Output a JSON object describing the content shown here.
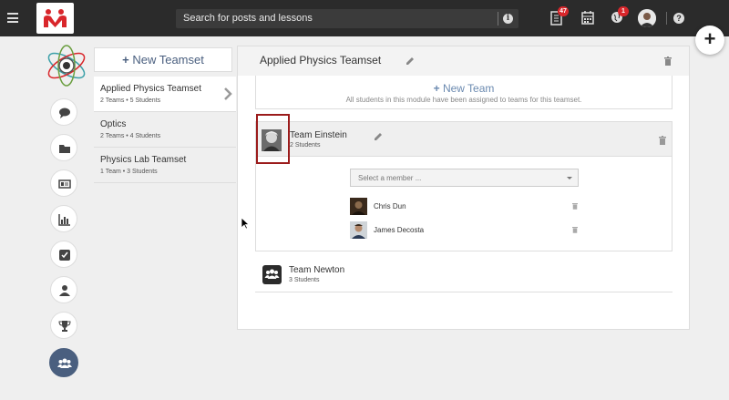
{
  "topbar": {
    "search_placeholder": "Search for posts and lessons",
    "notifications_count": "47",
    "globe_count": "1"
  },
  "sidebar_nav": {
    "icons": [
      "chat-icon",
      "folder-icon",
      "id-card-icon",
      "bar-chart-icon",
      "checkbox-icon",
      "user-icon",
      "trophy-icon",
      "users-icon"
    ],
    "active": "users-icon"
  },
  "teamsets": {
    "new_button": "New Teamset",
    "items": [
      {
        "name": "Applied Physics Teamset",
        "sub": "2 Teams • 5 Students",
        "selected": true
      },
      {
        "name": "Optics",
        "sub": "2 Teams • 4 Students",
        "selected": false
      },
      {
        "name": "Physics Lab Teamset",
        "sub": "1 Team • 3 Students",
        "selected": false
      }
    ]
  },
  "panel": {
    "title": "Applied Physics Teamset",
    "new_team_label": "New Team",
    "new_team_note": "All students in this module have been assigned to teams for this teamset.",
    "teams": [
      {
        "name": "Team Einstein",
        "count": "2 Students",
        "select_placeholder": "Select a member ...",
        "members": [
          {
            "name": "Chris Dun"
          },
          {
            "name": "James Decosta"
          }
        ]
      },
      {
        "name": "Team Newton",
        "count": "3 Students"
      }
    ]
  },
  "colors": {
    "topbar": "#2b2b2b",
    "accent": "#4a5f7f",
    "badge": "#d9262b",
    "highlight_border": "#9b1b1b",
    "brand": "#d9262b"
  }
}
